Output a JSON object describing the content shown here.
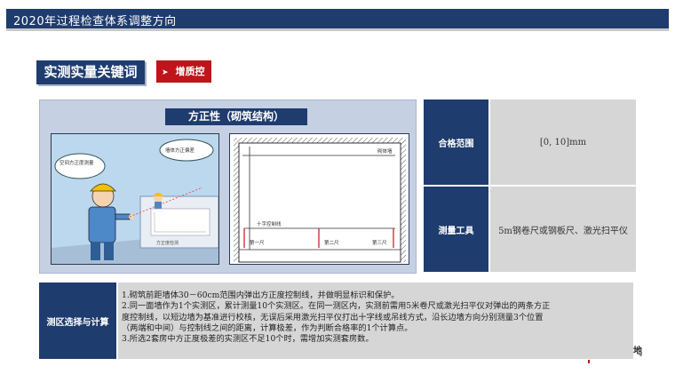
{
  "header": {
    "title": "2020年过程检查体系调整方向"
  },
  "keyword": {
    "label": "实测实量关键词"
  },
  "tag": {
    "icon": "chevron-right",
    "label": "增质控"
  },
  "illustration": {
    "title": "方正性（砌筑结构）",
    "bubble1": "空间方正度测量",
    "bubble2": "墙体方正偏差",
    "screen_label": "方正度检测",
    "drawing": {
      "wall_label": "砌体墙",
      "control_line": "十字控制线",
      "ruler1": "第一尺",
      "ruler2": "第二尺",
      "ruler3": "第三尺"
    }
  },
  "table": {
    "rows": [
      {
        "header": "合格范围",
        "value": "[0, 10]mm"
      },
      {
        "header": "测量工具",
        "value": "5m钢卷尺或钢板尺、激光扫平仪"
      }
    ]
  },
  "bottom": {
    "header": "测区选择与计算",
    "lines": [
      "1.砌筑前距墙体30－60cm范围内弹出方正度控制线，并做明显标识和保护。",
      "2.同一面墙作为1个实测区，累计测量10个实测区。在同一测区内，实测前需用5米卷尺或激光扫平仪对弹出的两条方正",
      "度控制线，以短边墙为基准进行校核，无误后采用激光扫平仪打出十字线或吊线方式，沿长边墙方向分别测量3个位置",
      "（两端和中间）与控制线之间的距离，计算极差，作为判断合格率的1个计算点。",
      "3.所选2套房中方正度极差的实测区不足10个时，需增加实测套房数。"
    ]
  },
  "corner_text": "地",
  "colors": {
    "navy": "#1f3c6e",
    "red": "#c0141b",
    "gray": "#d6d6d6"
  }
}
